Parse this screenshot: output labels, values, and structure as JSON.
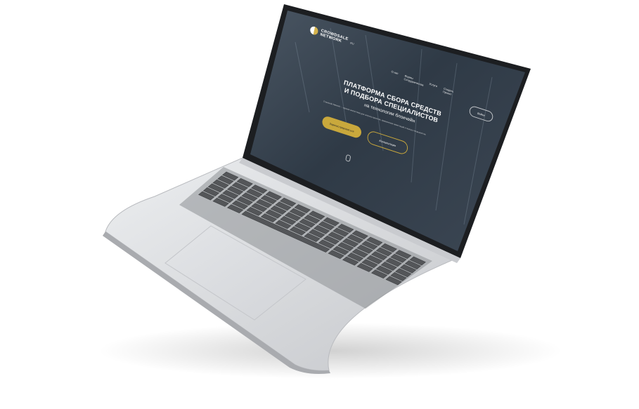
{
  "site": {
    "brand_line1": "CROWDSALE",
    "brand_line2": "NETWORK",
    "lang": "RU",
    "nav": [
      "О нас",
      "Формы Сотрудничества",
      "Услуги",
      "Создать Проект"
    ],
    "login_label": "Войти",
    "title_line1": "ПЛАТФОРМА СБОРА СРЕДСТВ",
    "title_line2": "И ПОДБОРА СПЕЦИАЛИСТОВ",
    "subtitle": "на технологии блокчейн",
    "description": "Crowdsale Network — единая экосистема для запуска проектов, привлечения инвестиций и поиска специалистов.",
    "cta_primary": "Зарегистрироваться",
    "cta_secondary": "Консультация"
  },
  "colors": {
    "accent": "#c9a83c",
    "screen_bg": "#33404c",
    "body": "#d6d8db",
    "keys": "#545659"
  }
}
